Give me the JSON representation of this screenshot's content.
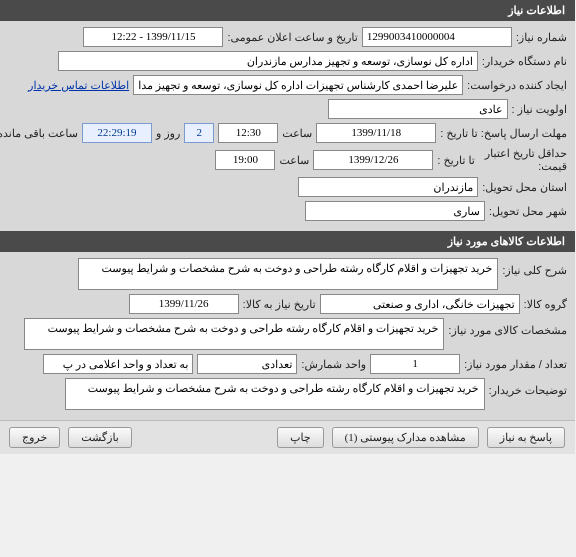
{
  "section1": {
    "title": "اطلاعات نیاز",
    "need_no_label": "شماره نیاز:",
    "need_no": "1299003410000004",
    "announce_datetime_label": "تاریخ و ساعت اعلان عمومی:",
    "announce_datetime": "1399/11/15 - 12:22",
    "buyer_org_label": "نام دستگاه خریدار:",
    "buyer_org": "اداره کل نوسازی، توسعه و تجهیز مدارس مازندران",
    "creator_label": "ایجاد کننده درخواست:",
    "creator": "علیرضا احمدی کارشناس تجهیزات اداره کل نوسازی، توسعه و تجهیز مدارس مازن",
    "priority_label": "اولویت نیاز :",
    "priority": "عادی",
    "contact_link": "اطلاعات تماس خریدار",
    "deadline_label": "مهلت ارسال پاسخ:  تا تاریخ :",
    "deadline_date": "1399/11/18",
    "time_label": "ساعت",
    "deadline_time": "12:30",
    "days_count": "2",
    "days_label": "روز و",
    "countdown": "22:29:19",
    "remaining_label": "ساعت باقی مانده",
    "min_valid_label1": "حداقل تاریخ اعتبار",
    "min_valid_label2": "قیمت:",
    "min_valid_to_label": "تا تاریخ :",
    "min_valid_date": "1399/12/26",
    "min_valid_time": "19:00",
    "province_label": "استان محل تحویل:",
    "province": "مازندران",
    "city_label": "شهر محل تحویل:",
    "city": "ساری"
  },
  "section2": {
    "title": "اطلاعات کالاهای مورد نیاز",
    "general_desc_label": "شرح کلی نیاز:",
    "general_desc": "خرید تجهیزات و اقلام کارگاه رشته طراحی و دوخت به شرح مشخصات و شرایط پیوست",
    "group_label": "گروه کالا:",
    "group": "تجهیزات خانگی، اداری و صنعتی",
    "need_date_label": "تاریخ نیاز به کالا:",
    "need_date": "1399/11/26",
    "spec_label": "مشخصات کالای مورد نیاز:",
    "spec": "خرید تجهیزات و اقلام کارگاه رشته طراحی و دوخت به شرح مشخصات و شرایط پیوست",
    "qty_label": "تعداد / مقدار مورد نیاز:",
    "qty": "1",
    "unit_label": "واحد شمارش:",
    "unit": "تعدادی",
    "per_unit_label": "به تعداد و واحد اعلامی در پ",
    "buyer_notes_label": "توضیحات خریدار:",
    "buyer_notes": "خرید تجهیزات و اقلام کارگاه رشته طراحی و دوخت به شرح مشخصات و شرایط پیوست"
  },
  "buttons": {
    "respond": "پاسخ به نیاز",
    "attachments": "مشاهده مدارک پیوستی (1)",
    "print": "چاپ",
    "back": "بازگشت",
    "exit": "خروج"
  }
}
